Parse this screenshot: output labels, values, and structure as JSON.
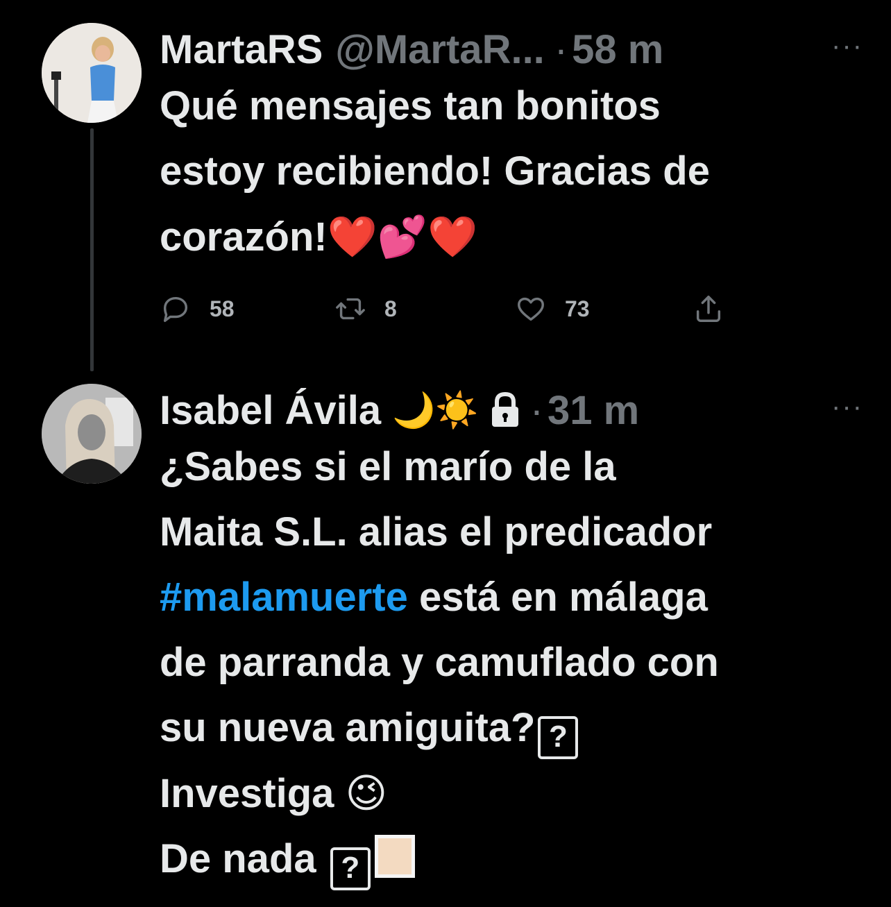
{
  "top_partial_text": "",
  "tweets": [
    {
      "name": "MartaRS",
      "handle": "@MartaR...",
      "separator": "·",
      "time": "58 m",
      "body_lines": [
        "Qué mensajes tan bonitos",
        "estoy recibiendo! Gracias de",
        "corazón!"
      ],
      "body_emoji": "❤️💕❤️",
      "actions": {
        "reply": "58",
        "retweet": "8",
        "like": "73"
      }
    },
    {
      "name": "Isabel Ávila",
      "name_emoji": "🌙☀️",
      "separator": "·",
      "time": "31 m",
      "line1": "¿Sabes si el marío de la",
      "line2": "Maita S.L. alias el predicador",
      "hashtag": "#malamuerte",
      "line3_rest": " está en málaga",
      "line4": "de parranda y camuflado con",
      "line5": "su nueva amiguita?",
      "line6": "Investiga",
      "line6_emoji": "😉",
      "line7": "De nada",
      "unknown_glyph": "?"
    }
  ],
  "more_label": "···",
  "colors": {
    "background": "#000000",
    "text": "#e7e9ea",
    "muted": "#71767b",
    "link": "#1d9bf0"
  }
}
